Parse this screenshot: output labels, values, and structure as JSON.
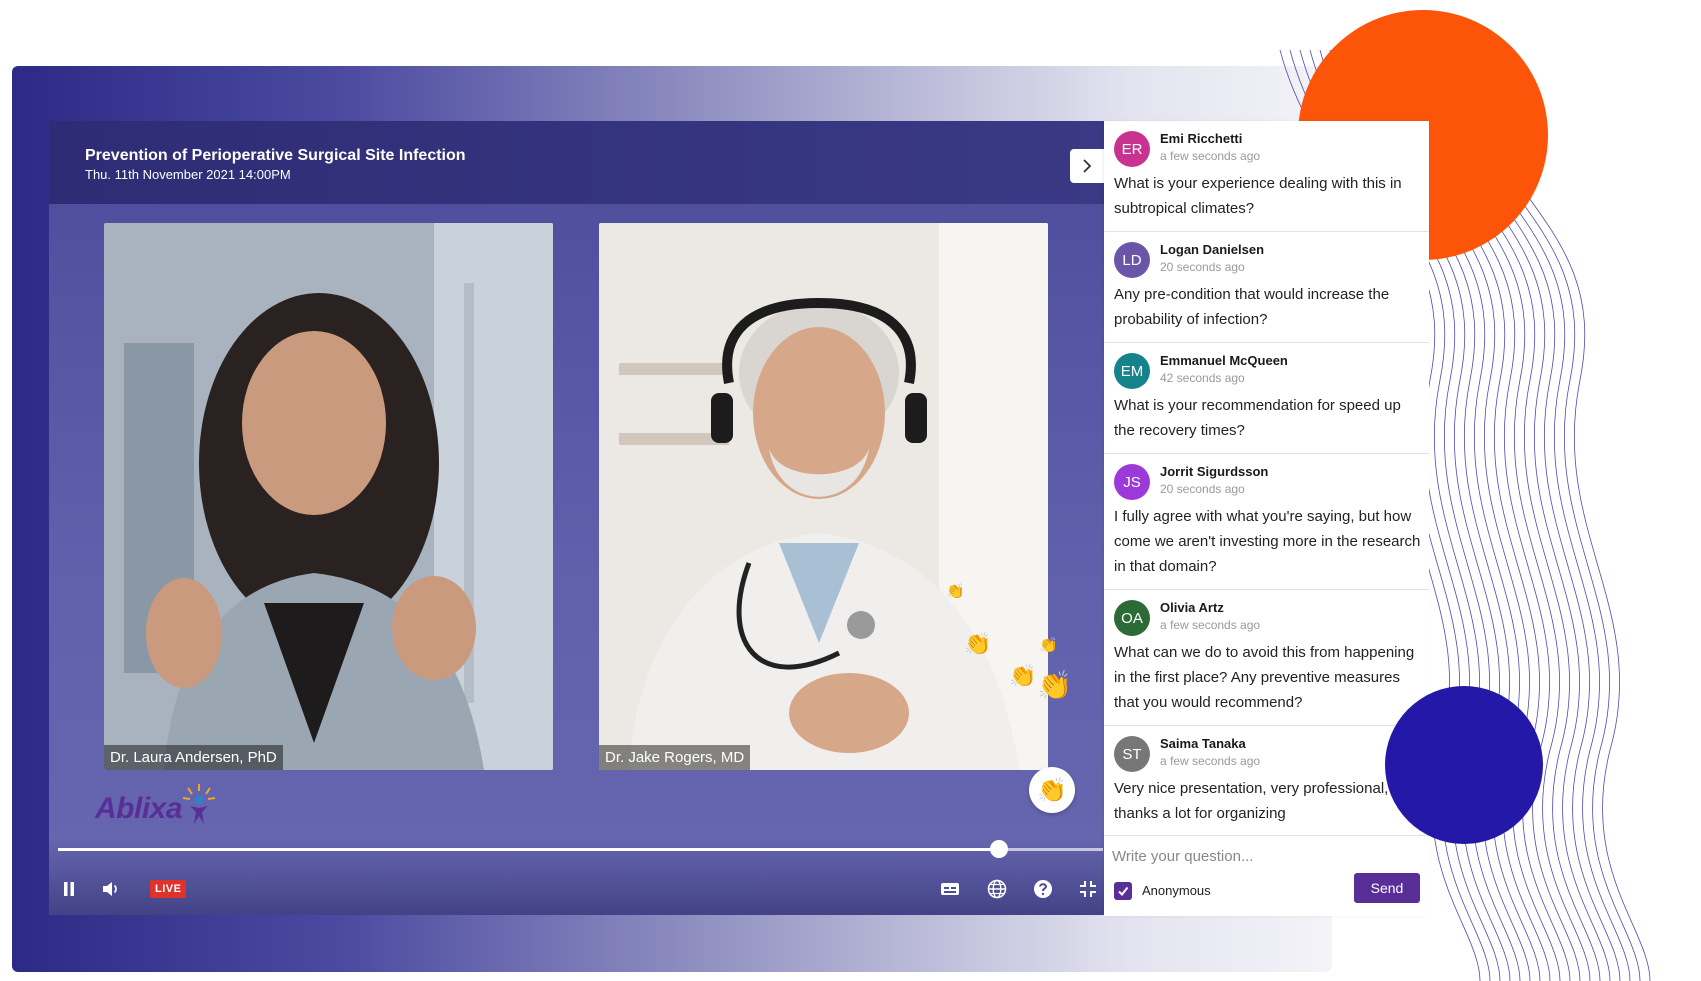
{
  "session": {
    "title": "Prevention of Perioperative Surgical Site Infection",
    "date": "Thu. 11th November 2021 14:00PM"
  },
  "speakers": [
    {
      "label": "Dr. Laura Andersen, PhD"
    },
    {
      "label": "Dr. Jake Rogers, MD"
    }
  ],
  "brand": {
    "name": "Ablixa",
    "logo_icon": "sunburst-person-icon"
  },
  "player": {
    "progress": 0.9,
    "live_label": "LIVE",
    "controls": [
      "pause-icon",
      "volume-icon",
      "captions-icon",
      "globe-icon",
      "help-icon",
      "compress-icon"
    ],
    "reaction_icon": "clapping-hands-icon"
  },
  "qa": {
    "questions": [
      {
        "initials": "ER",
        "name": "Emi Ricchetti",
        "time": "a few seconds ago",
        "text": "What is your experience dealing with this in subtropical climates?",
        "color": "#c8338f"
      },
      {
        "initials": "LD",
        "name": "Logan Danielsen",
        "time": "20 seconds ago",
        "text": "Any pre-condition that would increase the probability of infection?",
        "color": "#6b55a8"
      },
      {
        "initials": "EM",
        "name": "Emmanuel McQueen",
        "time": "42 seconds ago",
        "text": "What is your recommendation for speed up the recovery times?",
        "color": "#15838b"
      },
      {
        "initials": "JS",
        "name": "Jorrit Sigurdsson",
        "time": "20 seconds ago",
        "text": "I fully agree with what you're saying, but how come we aren't investing more in the research in that domain?",
        "color": "#9b3ad8"
      },
      {
        "initials": "OA",
        "name": "Olivia Artz",
        "time": "a few seconds ago",
        "text": "What can we do to avoid this from happening in the first place? Any preventive measures that you would recommend?",
        "color": "#2c6a38"
      },
      {
        "initials": "ST",
        "name": "Saima Tanaka",
        "time": "a few seconds ago",
        "text": "Very nice presentation, very professional, thanks a lot for organizing",
        "color": "#777777"
      }
    ],
    "input_placeholder": "Write your question...",
    "anonymous_label": "Anonymous",
    "anonymous_checked": true,
    "send_label": "Send"
  }
}
